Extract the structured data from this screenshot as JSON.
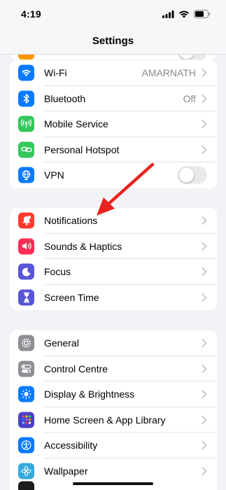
{
  "status_bar": {
    "time": "4:19"
  },
  "nav": {
    "title": "Settings"
  },
  "group1": [
    {
      "label": "Wi-Fi",
      "value": "AMARNATH",
      "icon": "wifi-icon",
      "color": "#0a7aff"
    },
    {
      "label": "Bluetooth",
      "value": "Off",
      "icon": "bluetooth-icon",
      "color": "#0a7aff"
    },
    {
      "label": "Mobile Service",
      "value": "",
      "icon": "antenna-icon",
      "color": "#34c759"
    },
    {
      "label": "Personal Hotspot",
      "value": "",
      "icon": "link-icon",
      "color": "#34c759"
    },
    {
      "label": "VPN",
      "value": "",
      "icon": "globe-icon",
      "color": "#0a7aff",
      "toggle": false
    }
  ],
  "group2": [
    {
      "label": "Notifications",
      "icon": "bell-icon",
      "color": "#ff3b30"
    },
    {
      "label": "Sounds & Haptics",
      "icon": "speaker-icon",
      "color": "#ff2d55"
    },
    {
      "label": "Focus",
      "icon": "moon-icon",
      "color": "#5856d6"
    },
    {
      "label": "Screen Time",
      "icon": "hourglass-icon",
      "color": "#5856d6"
    }
  ],
  "group3": [
    {
      "label": "General",
      "icon": "gear-icon",
      "color": "#8e8e93"
    },
    {
      "label": "Control Centre",
      "icon": "switches-icon",
      "color": "#8e8e93"
    },
    {
      "label": "Display & Brightness",
      "icon": "sun-icon",
      "color": "#0a7aff"
    },
    {
      "label": "Home Screen & App Library",
      "icon": "app-grid-icon",
      "color": "#5856d6"
    },
    {
      "label": "Accessibility",
      "icon": "accessibility-icon",
      "color": "#0a7aff"
    },
    {
      "label": "Wallpaper",
      "icon": "flower-icon",
      "color": "#35aadc"
    }
  ]
}
